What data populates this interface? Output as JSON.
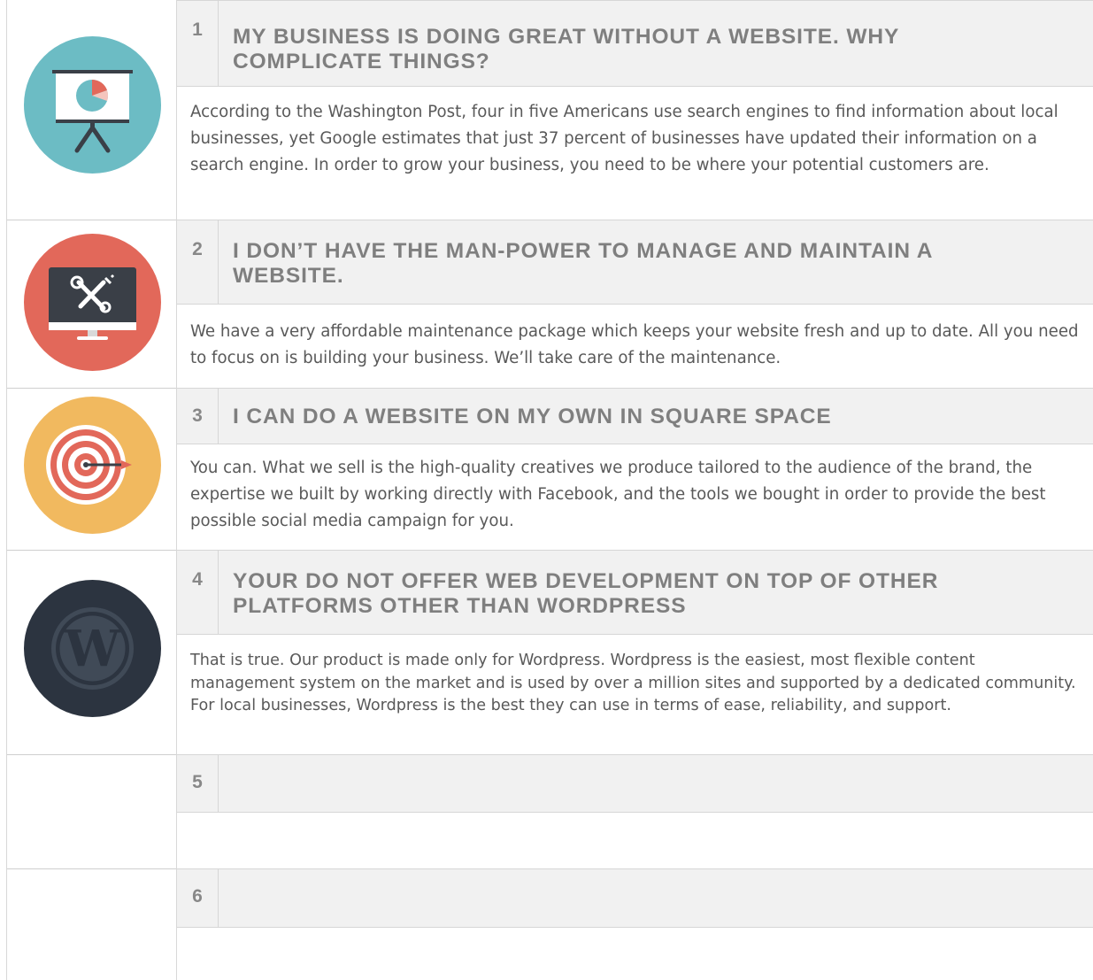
{
  "faqs": [
    {
      "number": "1",
      "question": "MY BUSINESS IS DOING GREAT WITHOUT A WEBSITE. WHY COMPLICATE THINGS?",
      "answer": "According to the Washington Post, four in five Americans use search engines to find information about local businesses, yet Google estimates that just 37 percent of businesses have updated their information on a search engine. In order to grow your business, you need to be where your potential customers are.",
      "icon": "presentation-chart-icon",
      "icon_color": "#6cbcc4"
    },
    {
      "number": "2",
      "question": "I DON’T HAVE THE MAN-POWER TO MANAGE AND MAINTAIN A WEBSITE.",
      "answer": "We have a very affordable maintenance package which keeps your website fresh and up to date. All you need to focus on is building your business. We’ll take care of the maintenance.",
      "icon": "monitor-tools-icon",
      "icon_color": "#e2685a"
    },
    {
      "number": "3",
      "question": "I CAN DO A WEBSITE ON MY OWN IN SQUARE SPACE",
      "answer": "You can. What we sell is the high-quality creatives we produce tailored to the audience of the brand, the expertise we built by working directly with Facebook, and the tools we bought in order to provide the best possible social media campaign for you.",
      "icon": "target-arrow-icon",
      "icon_color": "#f1b95f"
    },
    {
      "number": "4",
      "question": "YOUR DO NOT OFFER WEB DEVELOPMENT ON TOP OF OTHER PLATFORMS OTHER THAN WORDPRESS",
      "answer": "That is true. Our product is made only for Wordpress. Wordpress is the easiest, most flexible content management system on the market and is used by over a million sites and supported by a dedicated community. For local businesses, Wordpress is the best they can use in terms of ease, reliability, and support.",
      "icon": "wordpress-logo-icon",
      "icon_color": "#2c3440"
    },
    {
      "number": "5",
      "question": "",
      "answer": ""
    },
    {
      "number": "6",
      "question": "",
      "answer": ""
    }
  ]
}
